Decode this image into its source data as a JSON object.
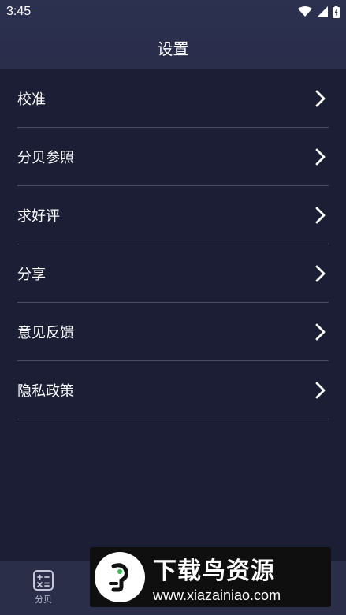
{
  "status_bar": {
    "time": "3:45"
  },
  "header": {
    "title": "设置"
  },
  "menu": {
    "items": [
      {
        "label": "校准"
      },
      {
        "label": "分贝参照"
      },
      {
        "label": "求好评"
      },
      {
        "label": "分享"
      },
      {
        "label": "意见反馈"
      },
      {
        "label": "隐私政策"
      }
    ]
  },
  "bottom_nav": {
    "tabs": [
      {
        "label": "分贝",
        "icon": "calculator-icon"
      }
    ]
  },
  "watermark": {
    "title": "下载鸟资源",
    "url": "www.xiazainiao.com"
  },
  "colors": {
    "background": "#1b1e34",
    "header": "#2c3150",
    "divider": "#4a4e66"
  }
}
